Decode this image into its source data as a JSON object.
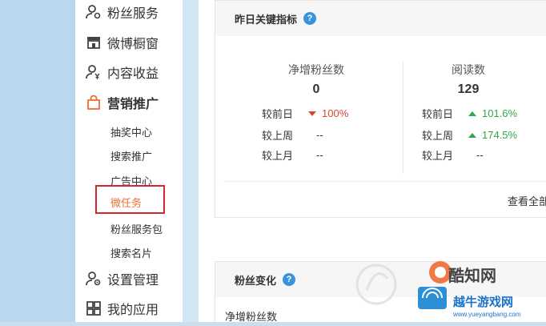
{
  "sidebar": {
    "items": [
      {
        "label": "粉丝服务",
        "icon": "person-gear-icon"
      },
      {
        "label": "微博橱窗",
        "icon": "storefront-icon"
      },
      {
        "label": "内容收益",
        "icon": "person-yen-icon"
      },
      {
        "label": "营销推广",
        "icon": "shopping-bag-icon"
      },
      {
        "label": "设置管理",
        "icon": "person-settings-icon"
      },
      {
        "label": "我的应用",
        "icon": "apps-grid-icon"
      }
    ],
    "sub_items": [
      {
        "label": "抽奖中心"
      },
      {
        "label": "搜索推广"
      },
      {
        "label": "广告中心"
      },
      {
        "label": "微任务"
      },
      {
        "label": "粉丝服务包"
      },
      {
        "label": "搜索名片"
      }
    ]
  },
  "card1": {
    "title": "昨日关键指标",
    "metrics": [
      {
        "name": "净增粉丝数",
        "value": "0",
        "rows": [
          {
            "label": "较前日",
            "value": "100%",
            "trend": "down"
          },
          {
            "label": "较上周",
            "value": "--",
            "trend": "none"
          },
          {
            "label": "较上月",
            "value": "--",
            "trend": "none"
          }
        ]
      },
      {
        "name": "阅读数",
        "value": "129",
        "rows": [
          {
            "label": "较前日",
            "value": "101.6%",
            "trend": "up"
          },
          {
            "label": "较上周",
            "value": "174.5%",
            "trend": "up"
          },
          {
            "label": "较上月",
            "value": "--",
            "trend": "none"
          }
        ]
      }
    ],
    "view_all": "查看全部"
  },
  "card2": {
    "title": "粉丝变化",
    "subtitle": "净增粉丝数"
  },
  "watermark": {
    "brand": "酷知网",
    "brand2": "越牛游戏网",
    "url": "www.yueyangbang.com"
  },
  "colors": {
    "accent_orange": "#f06d32",
    "highlight_red": "#d3262e",
    "help_blue": "#3b94d9",
    "trend_up": "#33a54a",
    "trend_down": "#d6472f"
  }
}
